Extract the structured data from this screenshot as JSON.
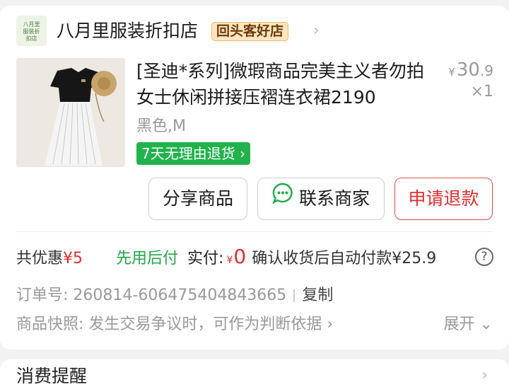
{
  "store": {
    "logo_text": [
      "八月里",
      "服装折",
      "扣店"
    ],
    "name": "八月里服装折扣店",
    "badge": "回头客好店"
  },
  "product": {
    "title": "[圣迪*系列]微瑕商品完美主义者勿拍女士休闲拼接压褶连衣裙2190",
    "price_currency": "¥",
    "price_int": "30",
    "price_dec": ".9",
    "qty": "×1",
    "spec": "黑色,M",
    "return_tag": "7天无理由退货"
  },
  "actions": {
    "share": "分享商品",
    "contact": "联系商家",
    "refund": "申请退款"
  },
  "payment": {
    "discount_label": "共优惠",
    "discount_value": "¥5",
    "bnpl": "先用后付",
    "paid_label": "实付:",
    "paid_currency": "¥",
    "paid_value": "0",
    "auto_pay": "确认收货后自动付款¥25.9",
    "help": "?"
  },
  "order": {
    "number_label": "订单号:",
    "number": "260814-606475404843665",
    "copy": "复制",
    "snapshot_label": "商品快照:",
    "snapshot_text": "发生交易争议时，可作为判断依据",
    "expand": "展开"
  },
  "reminder": {
    "title": "消费提醒"
  },
  "colors": {
    "red": "#e02e2e",
    "green": "#1faa43",
    "tag_green": "#22b24c"
  }
}
